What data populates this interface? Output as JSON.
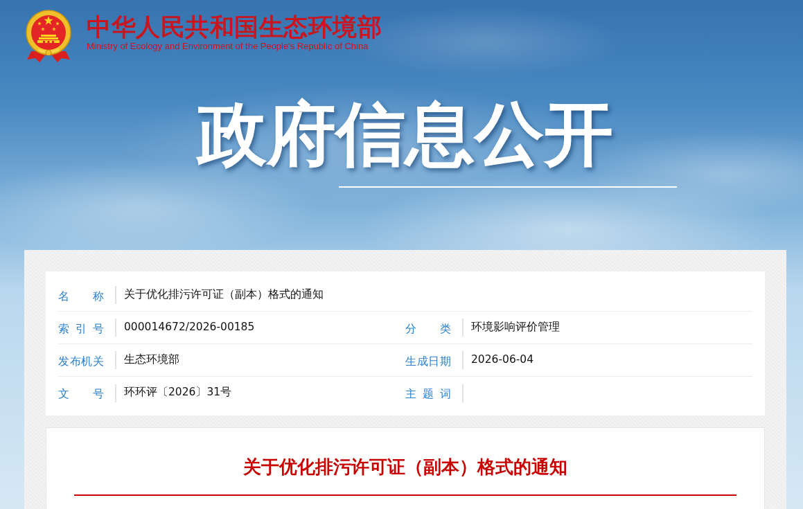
{
  "header": {
    "title": "中华人民共和国生态环境部",
    "subtitle": "Ministry of Ecology and Environment of the People's Republic of China"
  },
  "banner": {
    "heading": "政府信息公开"
  },
  "info": {
    "rows": [
      {
        "fields": [
          {
            "label": "名 称",
            "value": "关于优化排污许可证（副本）格式的通知"
          }
        ]
      },
      {
        "fields": [
          {
            "label": "索 引 号",
            "value": "000014672/2026-00185"
          },
          {
            "label": "分 类",
            "value": "环境影响评价管理"
          }
        ]
      },
      {
        "fields": [
          {
            "label": "发布机关",
            "value": "生态环境部"
          },
          {
            "label": "生成日期",
            "value": "2026-06-04"
          }
        ]
      },
      {
        "fields": [
          {
            "label": "文 号",
            "value": "环环评〔2026〕31号"
          },
          {
            "label": "主 题 词"
          }
        ]
      }
    ]
  },
  "article": {
    "title": "关于优化排污许可证（副本）格式的通知"
  }
}
